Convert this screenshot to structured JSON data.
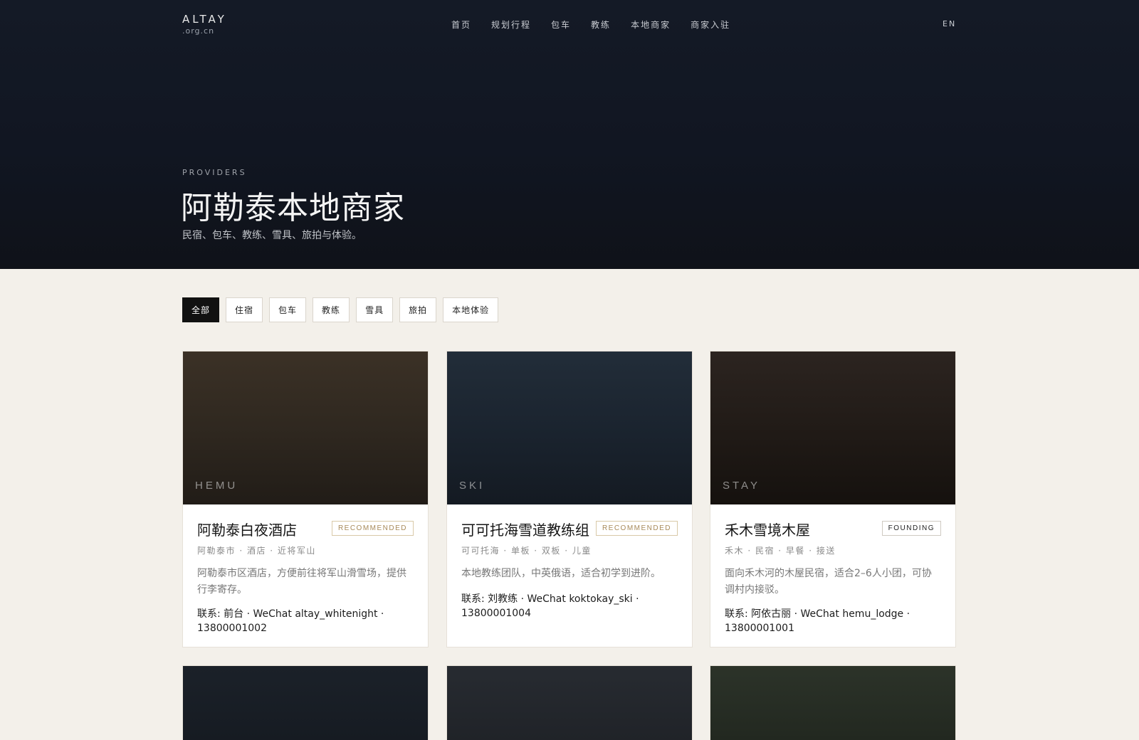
{
  "header": {
    "brand_name": "ALTAY",
    "brand_domain": ".org.cn",
    "nav": [
      "首页",
      "规划行程",
      "包车",
      "教练",
      "本地商家",
      "商家入驻"
    ],
    "lang": "EN"
  },
  "hero": {
    "eyebrow": "PROVIDERS",
    "title": "阿勒泰本地商家",
    "subtitle": "民宿、包车、教练、雪具、旅拍与体验。"
  },
  "filters": [
    "全部",
    "住宿",
    "包车",
    "教练",
    "雪具",
    "旅拍",
    "本地体验"
  ],
  "filters_active": "全部",
  "cards": [
    {
      "image_label": "HEMU",
      "title": "阿勒泰白夜酒店",
      "badge": "RECOMMENDED",
      "meta": "阿勒泰市 · 酒店 · 近将军山",
      "description": "阿勒泰市区酒店，方便前往将军山滑雪场，提供行李寄存。",
      "contact": "联系: 前台 · WeChat altay_whitenight · 13800001002"
    },
    {
      "image_label": "SKI",
      "title": "可可托海雪道教练组",
      "badge": "RECOMMENDED",
      "meta": "可可托海 · 单板 · 双板 · 儿童",
      "description": "本地教练团队，中英俄语，适合初学到进阶。",
      "contact": "联系: 刘教练 · WeChat koktokay_ski · 13800001004"
    },
    {
      "image_label": "STAY",
      "title": "禾木雪境木屋",
      "badge": "FOUNDING",
      "meta": "禾木 · 民宿 · 早餐 · 接送",
      "description": "面向禾木河的木屋民宿，适合2–6人小团，可协调村内接驳。",
      "contact": "联系: 阿依古丽 · WeChat hemu_lodge · 13800001001"
    }
  ],
  "colors": {
    "hero_bg": "#111622",
    "page_bg": "#f3f0ea",
    "badge_recommended": "#a88a5a",
    "chip_active_bg": "#111111"
  }
}
